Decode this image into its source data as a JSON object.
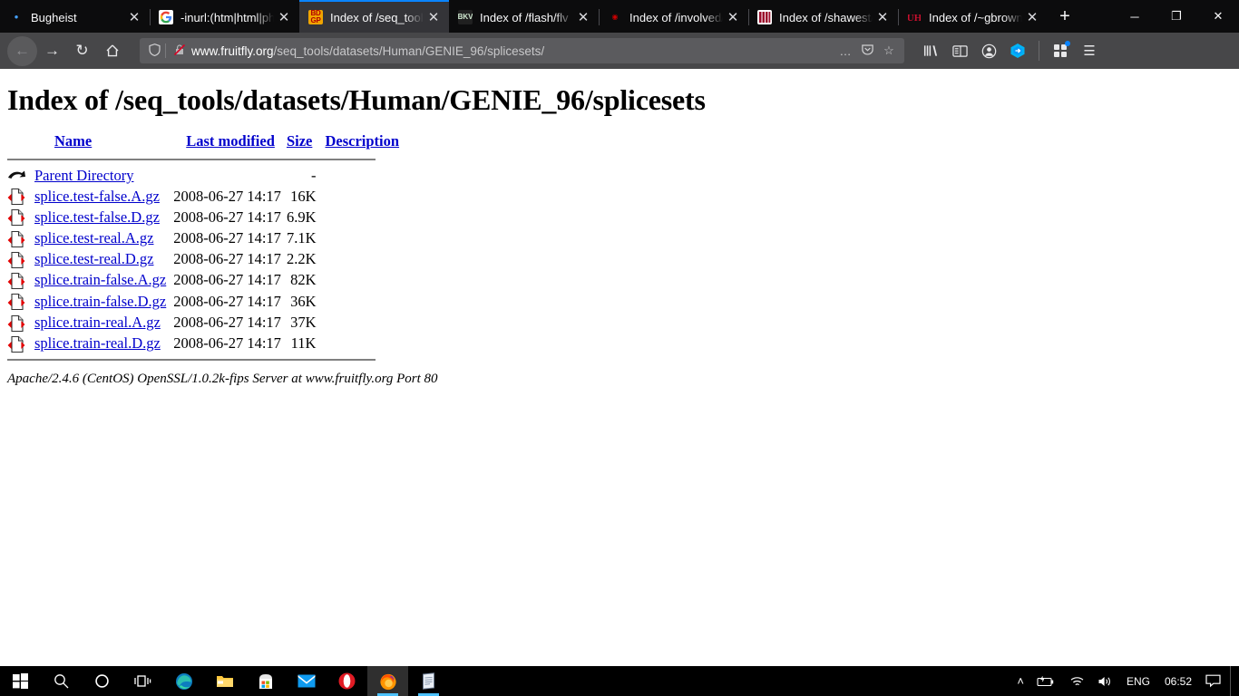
{
  "browser": {
    "tabs": [
      {
        "title": "Bugheist",
        "favicon": "bullet-favicon",
        "active": false
      },
      {
        "title": "-inurl:(htm|html|php",
        "favicon": "google-favicon",
        "active": false
      },
      {
        "title": "Index of /seq_tools/",
        "favicon": "bdgp-favicon",
        "active": true
      },
      {
        "title": "Index of /flash/flv",
        "favicon": "dark-favicon",
        "active": false
      },
      {
        "title": "Index of /involved/_",
        "favicon": "utah-favicon",
        "active": false
      },
      {
        "title": "Index of /shawest/P",
        "favicon": "bars-favicon",
        "active": false
      },
      {
        "title": "Index of /~gbrown",
        "favicon": "uh-favicon",
        "active": false
      }
    ],
    "new_tab_label": "+",
    "window_controls": {
      "minimize": "─",
      "restore": "❐",
      "close": "✕"
    },
    "nav": {
      "back": "←",
      "forward": "→",
      "reload": "↻",
      "home": "⌂",
      "url_host": "www.fruitfly.org",
      "url_path": "/seq_tools/datasets/Human/GENIE_96/splicesets/",
      "page_actions": "…",
      "pocket": "pocket-icon",
      "bookmark": "☆",
      "library": "library-icon",
      "sidebars": "sidebar-icon",
      "account": "account-icon",
      "container": "container-icon",
      "extension": "extension-icon",
      "menu": "☰"
    }
  },
  "page": {
    "title": "Index of /seq_tools/datasets/Human/GENIE_96/splicesets",
    "headers": {
      "name": "Name",
      "last_modified": "Last modified",
      "size": "Size",
      "description": "Description"
    },
    "parent": {
      "icon": "back-icon",
      "label": "Parent Directory",
      "date": "",
      "size": "-",
      "description": ""
    },
    "rows": [
      {
        "icon": "compressed-file-icon",
        "name": "splice.test-false.A.gz",
        "date": "2008-06-27 14:17",
        "size": "16K",
        "description": ""
      },
      {
        "icon": "compressed-file-icon",
        "name": "splice.test-false.D.gz",
        "date": "2008-06-27 14:17",
        "size": "6.9K",
        "description": ""
      },
      {
        "icon": "compressed-file-icon",
        "name": "splice.test-real.A.gz",
        "date": "2008-06-27 14:17",
        "size": "7.1K",
        "description": ""
      },
      {
        "icon": "compressed-file-icon",
        "name": "splice.test-real.D.gz",
        "date": "2008-06-27 14:17",
        "size": "2.2K",
        "description": ""
      },
      {
        "icon": "compressed-file-icon",
        "name": "splice.train-false.A.gz",
        "date": "2008-06-27 14:17",
        "size": "82K",
        "description": ""
      },
      {
        "icon": "compressed-file-icon",
        "name": "splice.train-false.D.gz",
        "date": "2008-06-27 14:17",
        "size": "36K",
        "description": ""
      },
      {
        "icon": "compressed-file-icon",
        "name": "splice.train-real.A.gz",
        "date": "2008-06-27 14:17",
        "size": "37K",
        "description": ""
      },
      {
        "icon": "compressed-file-icon",
        "name": "splice.train-real.D.gz",
        "date": "2008-06-27 14:17",
        "size": "11K",
        "description": ""
      }
    ],
    "footer": "Apache/2.4.6 (CentOS) OpenSSL/1.0.2k-fips Server at www.fruitfly.org Port 80"
  },
  "taskbar": {
    "items": [
      {
        "name": "start-button",
        "glyph": "start-icon"
      },
      {
        "name": "search-button",
        "glyph": "search-icon"
      },
      {
        "name": "cortana-button",
        "glyph": "cortana-icon"
      },
      {
        "name": "task-view-button",
        "glyph": "task-view-icon"
      },
      {
        "name": "edge-button",
        "glyph": "edge-icon"
      },
      {
        "name": "file-explorer-button",
        "glyph": "folder-icon"
      },
      {
        "name": "microsoft-store-button",
        "glyph": "store-icon"
      },
      {
        "name": "mail-button",
        "glyph": "mail-icon"
      },
      {
        "name": "opera-button",
        "glyph": "opera-icon"
      },
      {
        "name": "firefox-button",
        "glyph": "firefox-icon"
      },
      {
        "name": "notepad-button",
        "glyph": "notepad-icon"
      }
    ],
    "tray": {
      "chevron": "˄",
      "battery": "battery-icon",
      "network": "wifi-icon",
      "volume": "volume-icon",
      "language": "ENG",
      "clock": "06:52",
      "notifications": "notification-icon"
    }
  },
  "colors": {
    "link": "#0000cc",
    "tab_active_bg": "#343438",
    "tab_accent": "#0a84ff",
    "chrome_bg": "#0c0c0d",
    "toolbar_bg": "#474749",
    "taskbar_bg": "#000000"
  }
}
